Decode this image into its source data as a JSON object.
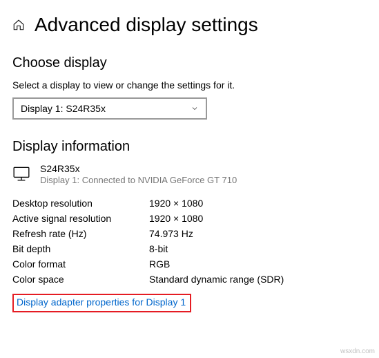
{
  "header": {
    "title": "Advanced display settings"
  },
  "choose_display": {
    "heading": "Choose display",
    "subtext": "Select a display to view or change the settings for it.",
    "selected": "Display 1: S24R35x"
  },
  "display_info": {
    "heading": "Display information",
    "name": "S24R35x",
    "status": "Display 1: Connected to NVIDIA GeForce GT 710",
    "rows": {
      "desktop_resolution": {
        "label": "Desktop resolution",
        "value": "1920 × 1080"
      },
      "active_resolution": {
        "label": "Active signal resolution",
        "value": "1920 × 1080"
      },
      "refresh_rate": {
        "label": "Refresh rate (Hz)",
        "value": "74.973 Hz"
      },
      "bit_depth": {
        "label": "Bit depth",
        "value": "8-bit"
      },
      "color_format": {
        "label": "Color format",
        "value": "RGB"
      },
      "color_space": {
        "label": "Color space",
        "value": "Standard dynamic range (SDR)"
      }
    },
    "adapter_link": "Display adapter properties for Display 1"
  },
  "watermark": "wsxdn.com"
}
